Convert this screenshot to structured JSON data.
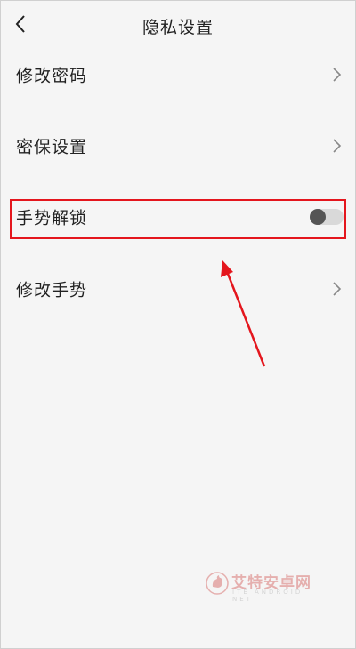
{
  "header": {
    "title": "隐私设置",
    "back_icon": "chevron-left-icon"
  },
  "rows": [
    {
      "label": "修改密码",
      "trailing": "chevron-right-icon"
    },
    {
      "label": "密保设置",
      "trailing": "chevron-right-icon"
    },
    {
      "label": "手势解锁",
      "trailing": "toggle",
      "toggle_on": false
    },
    {
      "label": "修改手势",
      "trailing": "chevron-right-icon"
    }
  ],
  "annotation": {
    "highlight_color": "#e4161d",
    "arrow_color": "#e4161d"
  },
  "watermark": {
    "text": "艾特安卓网",
    "subtext": "ITE ANDROID NET",
    "logo": "rooster-logo-icon"
  },
  "colors": {
    "background": "#f5f5f5",
    "text": "#222222",
    "toggle_track": "#d9d9d9",
    "toggle_knob": "#555555"
  }
}
